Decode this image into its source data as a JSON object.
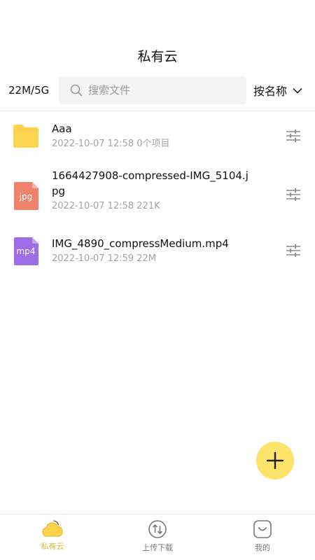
{
  "header": {
    "title": "私有云"
  },
  "toolbar": {
    "storage": "22M/5G",
    "search_placeholder": "搜索文件",
    "sort_label": "按名称"
  },
  "files": [
    {
      "name": "Aaa",
      "meta": "2022-10-07 12:58 0个项目",
      "icon": "folder-icon",
      "type_label": ""
    },
    {
      "name": "1664427908-compressed-IMG_5104.jpg",
      "meta": "2022-10-07 12:58 221K",
      "icon": "jpg-file-icon",
      "type_label": "jpg"
    },
    {
      "name": "IMG_4890_compressMedium.mp4",
      "meta": "2022-10-07 12:59 22M",
      "icon": "mp4-file-icon",
      "type_label": "mp4"
    }
  ],
  "tabs": [
    {
      "label": "私有云",
      "icon": "cloud-icon",
      "active": true
    },
    {
      "label": "上传下载",
      "icon": "transfer-icon",
      "active": false
    },
    {
      "label": "我的",
      "icon": "profile-icon",
      "active": false
    }
  ],
  "colors": {
    "accent": "#fce36a",
    "active_tab": "#e9b934",
    "folder": "#fcd349",
    "jpg": "#f0816d",
    "mp4": "#9d6ee8"
  }
}
